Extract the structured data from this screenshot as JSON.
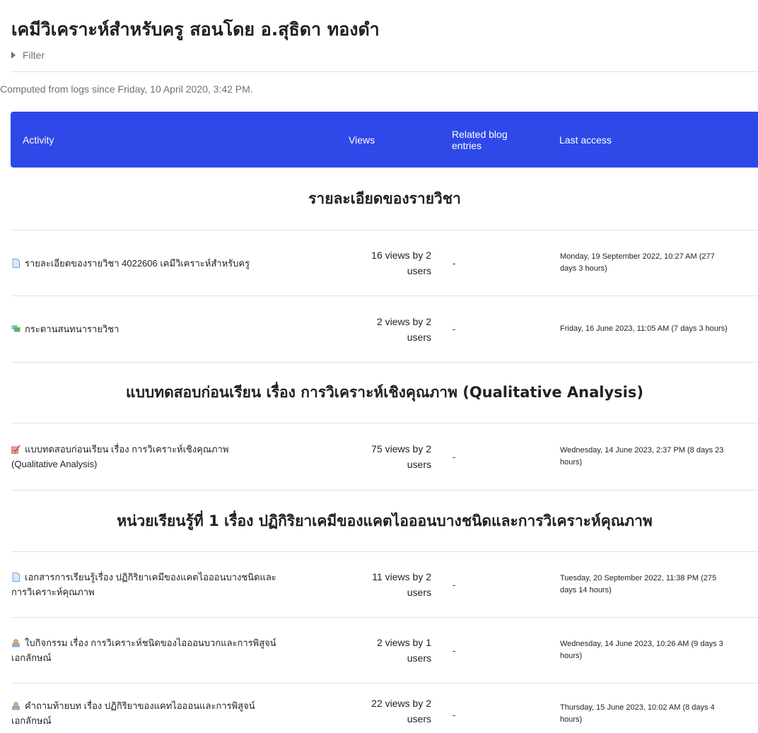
{
  "page": {
    "title": "เคมีวิเคราะห์สำหรับครู สอนโดย อ.สุธิดา ทองดำ",
    "filter_label": "Filter",
    "computed_text": "Computed from logs since Friday, 10 April 2020, 3:42 PM."
  },
  "table": {
    "headers": {
      "activity": "Activity",
      "views": "Views",
      "blog_line1": "Related blog",
      "blog_line2": "entries",
      "last_access": "Last access"
    },
    "sections": [
      {
        "title": "รายละเอียดของรายวิชา"
      },
      {
        "title": "แบบทดสอบก่อนเรียน เรื่อง การวิเคราะห์เชิงคุณภาพ (Qualitative Analysis)"
      },
      {
        "title": "หน่วยเรียนรู้ที่ 1 เรื่อง ปฏิกิริยาเคมีของแคตไอออนบางชนิดและการวิเคราะห์คุณภาพ"
      }
    ],
    "rows": [
      {
        "icon": "page-icon",
        "activity_line1": "รายละเอียดของรายวิชา 4022606 เคมีวิเคราะห์สำหรับครู",
        "activity_line2": "",
        "views_line1": "16 views by 2",
        "views_line2": "users",
        "blog": "-",
        "last_line1": "Monday, 19 September 2022, 10:27 AM (277",
        "last_line2": "days 3 hours)"
      },
      {
        "icon": "forum-icon",
        "activity_line1": "กระดานสนทนารายวิชา",
        "activity_line2": "",
        "views_line1": "2 views by 2",
        "views_line2": "users",
        "blog": "-",
        "last_line1": "Friday, 16 June 2023, 11:05 AM (7 days 3 hours)",
        "last_line2": ""
      },
      {
        "icon": "quiz-icon",
        "activity_line1": "แบบทดสอบก่อนเรียน เรื่อง การวิเคราะห์เชิงคุณภาพ",
        "activity_line2": "(Qualitative Analysis)",
        "views_line1": "75 views by 2",
        "views_line2": "users",
        "blog": "-",
        "last_line1": "Wednesday, 14 June 2023, 2:37 PM (8 days 23",
        "last_line2": "hours)"
      },
      {
        "icon": "page-icon",
        "activity_line1": "เอกสารการเรียนรู้เรื่อง ปฏิกิริยาเคมีของแคตไอออนบางชนิดและ",
        "activity_line2": "การวิเคราะห์คุณภาพ",
        "views_line1": "11 views by 2",
        "views_line2": "users",
        "blog": "-",
        "last_line1": "Tuesday, 20 September 2022, 11:38 PM (275",
        "last_line2": "days 14 hours)"
      },
      {
        "icon": "assignment-icon",
        "activity_line1": "ใบกิจกรรม เรื่อง การวิเคราะห์ชนิดของไอออนบวกและการพิสูจน์",
        "activity_line2": "เอกลักษณ์",
        "views_line1": "2 views by 1",
        "views_line2": "users",
        "blog": "-",
        "last_line1": "Wednesday, 14 June 2023, 10:26 AM (9 days 3",
        "last_line2": "hours)"
      },
      {
        "icon": "assignment-icon",
        "activity_line1": "คำถามท้ายบท เรื่อง ปฏิกิริยาของแคทไอออนและการพิสูจน์",
        "activity_line2": "เอกลักษณ์",
        "views_line1": "22 views by 2",
        "views_line2": "users",
        "blog": "-",
        "last_line1": "Thursday, 15 June 2023, 10:02 AM (8 days 4",
        "last_line2": "hours)"
      }
    ]
  },
  "colors": {
    "header_bg": "#2f49e9",
    "header_text": "#ffffff",
    "muted_text": "#6a737b",
    "border": "#dee2e6"
  }
}
